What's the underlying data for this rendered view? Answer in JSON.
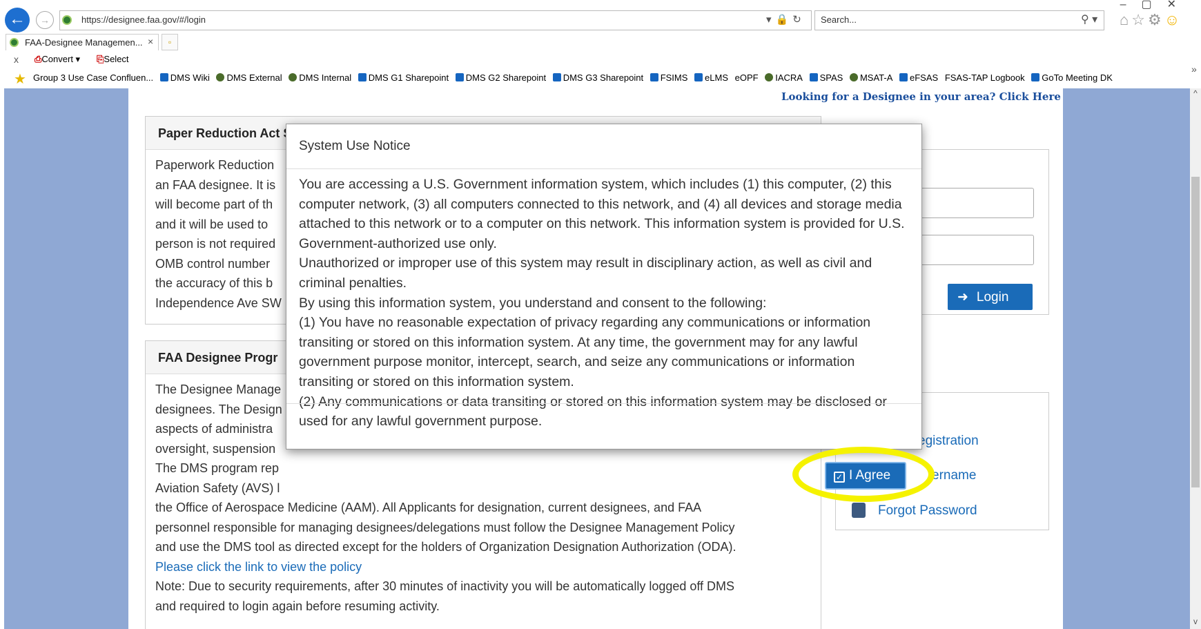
{
  "browser": {
    "url": "https://designee.faa.gov/#/login",
    "search_placeholder": "Search...",
    "tab_title": "FAA-Designee Managemen...",
    "tab_close": "×",
    "commands": {
      "close": "x",
      "convert": "Convert",
      "select": "Select"
    },
    "favorites": [
      "Group 3 Use Case Confluen...",
      "DMS Wiki",
      "DMS External",
      "DMS Internal",
      "DMS G1 Sharepoint",
      "DMS G2 Sharepoint",
      "DMS G3 Sharepoint",
      "FSIMS",
      "eLMS",
      "eOPF",
      "IACRA",
      "SPAS",
      "MSAT-A",
      "eFSAS",
      "FSAS-TAP Logbook",
      "GoTo Meeting DK"
    ]
  },
  "page": {
    "looking_link": "Looking for a Designee in your area? Click Here",
    "paper_panel": {
      "title": "Paper Reduction Act Statement",
      "lines": [
        "Paperwork Reduction",
        "an FAA designee. It is",
        "will become part of th",
        "and it will be used to",
        "person is not required",
        "OMB control number",
        "the accuracy of this b",
        "Independence Ave SW"
      ]
    },
    "program_panel": {
      "title": "FAA Designee Progr",
      "lines": [
        "The Designee Manage",
        "designees. The Design",
        "aspects of administra",
        "oversight, suspension",
        "The DMS program rep",
        "Aviation Safety (AVS) l"
      ],
      "full_lines": [
        "the Office of Aerospace Medicine (AAM). All Applicants for designation, current designees, and FAA",
        "personnel responsible for managing designees/delegations must follow the Designee Management Policy",
        "and use the DMS tool as directed except for the holders of Organization Designation Authorization (ODA)."
      ],
      "policy_link": "Please click the link to view the policy",
      "note_lines": [
        "Note: Due to security requirements, after 30 minutes of inactivity you will be automatically logged off DMS",
        "and required to login again before resuming activity."
      ]
    },
    "login": {
      "button": "Login"
    },
    "side_links": {
      "registration": "egistration",
      "username": "ername",
      "forgot": "Forgot Password"
    }
  },
  "modal": {
    "title": "System Use Notice",
    "paragraphs": [
      "You are accessing a U.S. Government information system, which includes (1) this computer, (2) this computer network, (3) all computers connected to this network, and (4) all devices and storage media attached to this network or to a computer on this network. This information system is provided for U.S. Government-authorized use only.",
      "Unauthorized or improper use of this system may result in disciplinary action, as well as civil and criminal penalties.",
      "By using this information system, you understand and consent to the following:",
      "(1) You have no reasonable expectation of privacy regarding any communications or information transiting or stored on this information system. At any time, the government may for any lawful government purpose monitor, intercept, search, and seize any communications or information transiting or stored on this information system.",
      "(2) Any communications or data transiting or stored on this information system may be disclosed or used for any lawful government purpose."
    ],
    "agree_button": "I Agree"
  },
  "colors": {
    "accent": "#1a6bb8",
    "highlight": "#f5f200",
    "page_bg": "#8fa8d4"
  }
}
